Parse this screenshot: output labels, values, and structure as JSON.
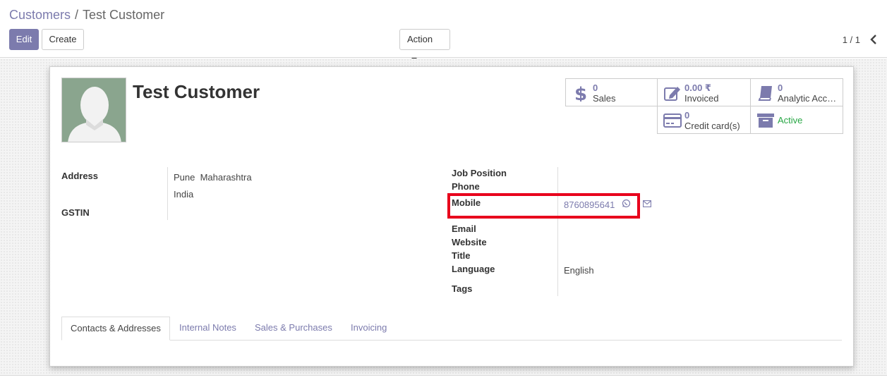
{
  "breadcrumb": {
    "parent": "Customers",
    "separator": "/",
    "current": "Test Customer"
  },
  "toolbar": {
    "edit_label": "Edit",
    "create_label": "Create",
    "action_label": "Action"
  },
  "pager": {
    "text": "1 / 1"
  },
  "customer": {
    "name": "Test Customer"
  },
  "smart_buttons": {
    "sales": {
      "value": "0",
      "label": "Sales"
    },
    "invoiced": {
      "value": "0.00 ₹",
      "label": "Invoiced"
    },
    "analytic": {
      "value": "0",
      "label": "Analytic Acc…"
    },
    "credit_cards": {
      "value": "0",
      "label": "Credit card(s)"
    },
    "active": {
      "label": "Active"
    }
  },
  "fields": {
    "address_label": "Address",
    "address_line1": "Pune  Maharashtra",
    "address_line2": "India",
    "gstin_label": "GSTIN",
    "job_position_label": "Job Position",
    "phone_label": "Phone",
    "mobile_label": "Mobile",
    "mobile_value": "8760895641",
    "email_label": "Email",
    "website_label": "Website",
    "title_label": "Title",
    "language_label": "Language",
    "language_value": "English",
    "tags_label": "Tags"
  },
  "tabs": [
    "Contacts & Addresses",
    "Internal Notes",
    "Sales & Purchases",
    "Invoicing"
  ],
  "colors": {
    "primary": "#7c7bad",
    "active": "#28a745",
    "highlight": "#e8001c"
  }
}
